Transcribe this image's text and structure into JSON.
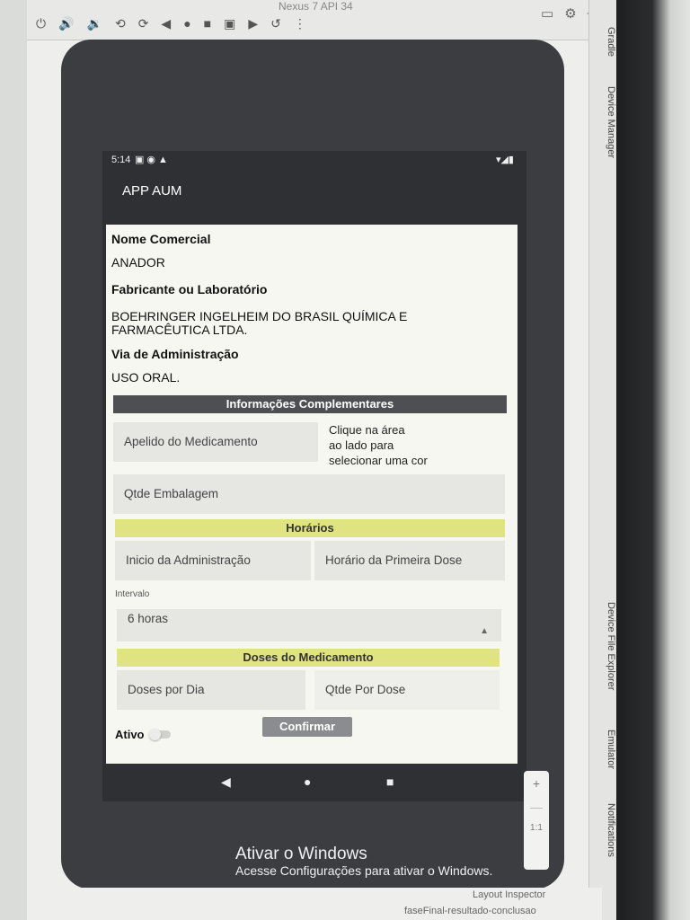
{
  "ide": {
    "tab_title": "Nexus 7 API 34",
    "side_labels": {
      "gradle": "Gradle",
      "device_manager": "Device Manager",
      "device_file_explorer": "Device File Explorer",
      "emulator": "Emulator",
      "notifications": "Notifications"
    },
    "layout_inspector": "Layout Inspector",
    "run_config": "faseFinal-resultado-conclusao",
    "zoom_plus": "+",
    "zoom_ratio": "1:1"
  },
  "device": {
    "status_time": "5:14",
    "app_title": "APP AUM"
  },
  "form": {
    "nome_comercial_label": "Nome Comercial",
    "nome_comercial_value": "ANADOR",
    "fabricante_label": "Fabricante ou Laboratório",
    "fabricante_value_line1": "BOEHRINGER INGELHEIM DO BRASIL QUÍMICA E",
    "fabricante_value_line2": "FARMACÊUTICA LTDA.",
    "via_label": "Via de Administração",
    "via_value": "USO ORAL.",
    "info_header": "Informações Complementares",
    "apelido_field": "Apelido do Medicamento",
    "color_hint_line1": "Clique na área",
    "color_hint_line2": "ao lado para",
    "color_hint_line3": "selecionar uma cor",
    "qtde_embalagem_field": "Qtde Embalagem",
    "horarios_header": "Horários",
    "inicio_field": "Inicio da Administração",
    "primeira_dose_field": "Horário da Primeira Dose",
    "intervalo_label": "Intervalo",
    "intervalo_value": "6 horas",
    "doses_header": "Doses do Medicamento",
    "doses_dia_field": "Doses por Dia",
    "qtde_dose_field": "Qtde Por Dose",
    "ativo_label": "Ativo",
    "confirm_button": "Confirmar"
  },
  "windows_watermark": {
    "title": "Ativar o Windows",
    "subtitle": "Acesse Configurações para ativar o Windows."
  }
}
